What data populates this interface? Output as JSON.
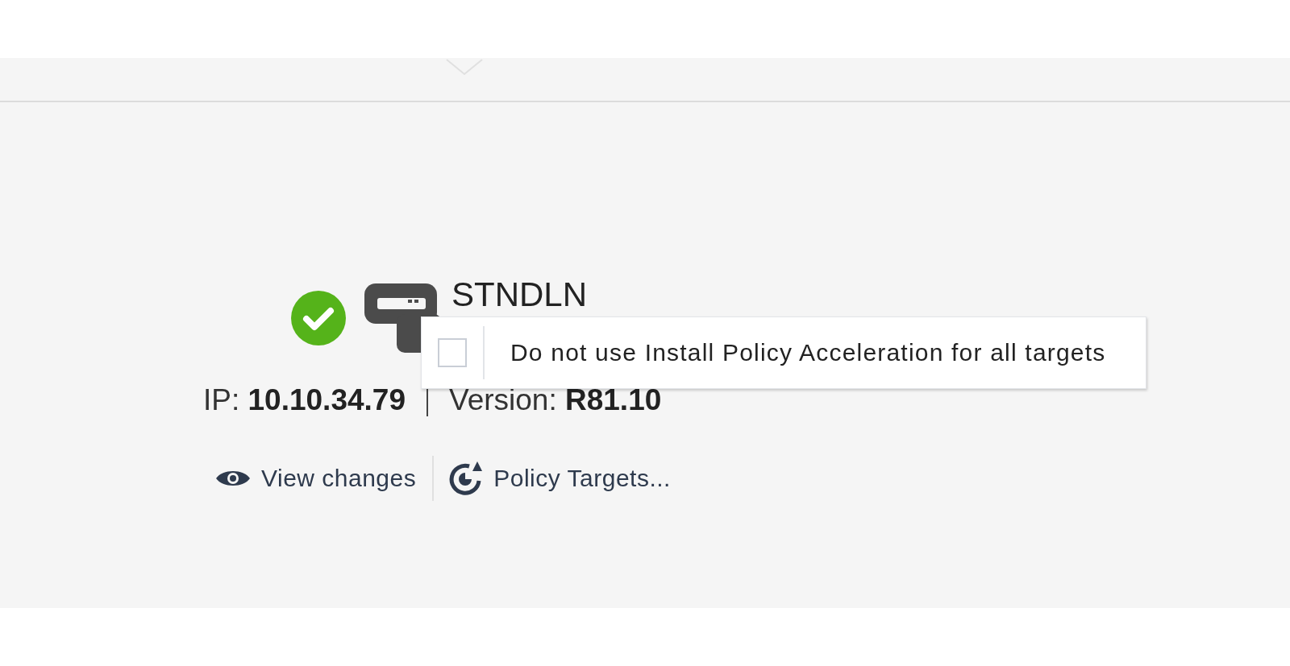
{
  "device": {
    "ok": true,
    "name": "STNDLN",
    "ip_label": "IP:",
    "ip": "10.10.34.79",
    "version_label": "Version:",
    "version": "R81.10"
  },
  "actions": [
    {
      "label": "View changes",
      "kind": "view"
    },
    {
      "label": "Policy Targets...",
      "kind": "targets"
    }
  ],
  "popup": {
    "items": [
      {
        "label": "Do not use Install Policy Acceleration for all targets",
        "checked": false
      }
    ]
  }
}
